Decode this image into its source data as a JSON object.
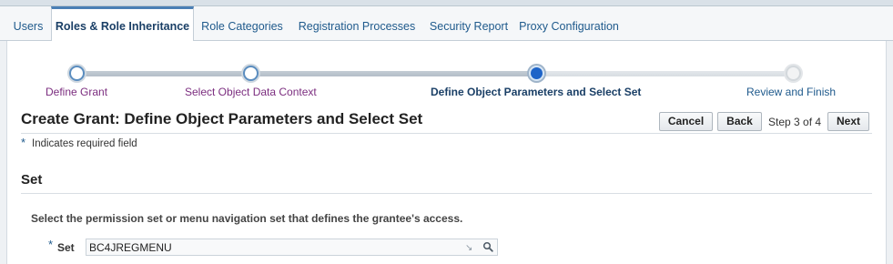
{
  "tabs": [
    {
      "label": "Users"
    },
    {
      "label": "Roles & Role Inheritance"
    },
    {
      "label": "Role Categories"
    },
    {
      "label": "Registration Processes"
    },
    {
      "label": "Security Report"
    },
    {
      "label": "Proxy Configuration"
    }
  ],
  "active_tab": "Roles & Role Inheritance",
  "train": {
    "steps": [
      {
        "label": "Define Grant",
        "state": "visited"
      },
      {
        "label": "Select Object Data Context",
        "state": "visited"
      },
      {
        "label": "Define Object Parameters and Select Set",
        "state": "current"
      },
      {
        "label": "Review and Finish",
        "state": "future"
      }
    ]
  },
  "page": {
    "title": "Create Grant: Define Object Parameters and Select Set",
    "cancel_label": "Cancel",
    "back_label": "Back",
    "step_indicator": "Step 3 of 4",
    "next_label": "Next",
    "required_star": "*",
    "required_note": "Indicates required field"
  },
  "set_section": {
    "header": "Set",
    "instruction": "Select the permission set or menu navigation set that defines the grantee's access.",
    "field_star": "*",
    "field_label": "Set",
    "field_value": "BC4JREGMENU"
  },
  "colors": {
    "link": "#1f5a8c",
    "visited_link": "#7b2d7f",
    "current_step": "#1e64c8"
  }
}
